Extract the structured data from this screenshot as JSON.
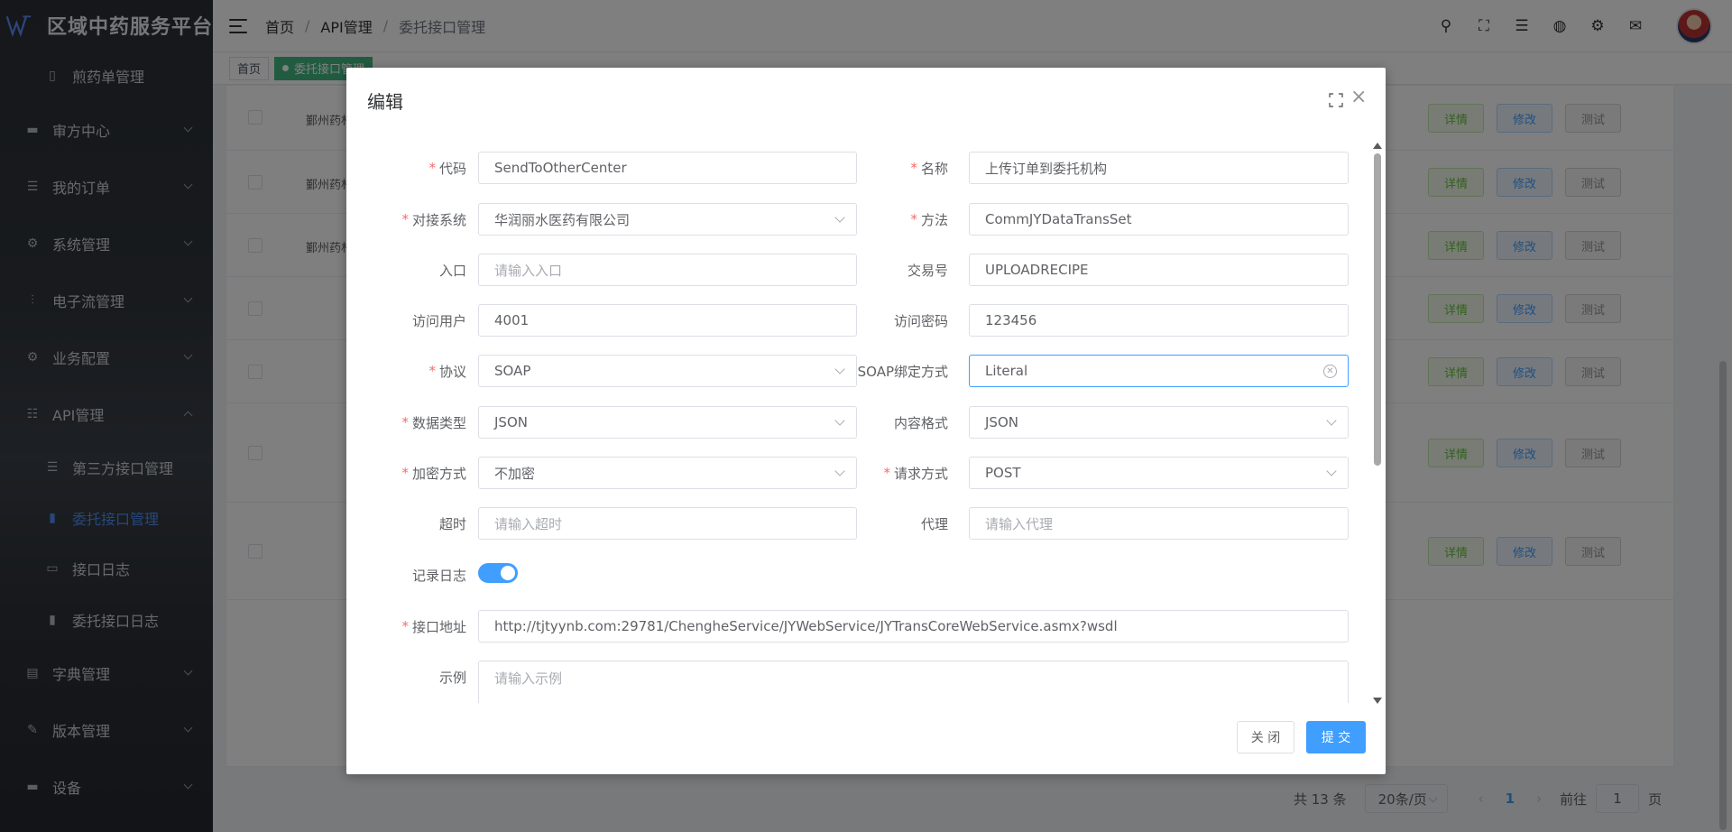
{
  "app": {
    "title": "区域中药服务平台"
  },
  "sidebar": {
    "items": [
      {
        "label": "煎药单管理",
        "icon": "document-icon"
      },
      {
        "label": "审方中心",
        "icon": "monitor-icon"
      },
      {
        "label": "我的订单",
        "icon": "list-icon"
      },
      {
        "label": "系统管理",
        "icon": "gear-icon"
      },
      {
        "label": "电子流管理",
        "icon": "sliders-icon"
      },
      {
        "label": "业务配置",
        "icon": "gear-icon"
      },
      {
        "label": "API管理",
        "icon": "sliders-icon"
      },
      {
        "label": "第三方接口管理",
        "icon": "list-icon"
      },
      {
        "label": "委托接口管理",
        "icon": "bar-chart-icon"
      },
      {
        "label": "接口日志",
        "icon": "log-icon"
      },
      {
        "label": "委托接口日志",
        "icon": "bar-chart-icon"
      },
      {
        "label": "字典管理",
        "icon": "book-icon"
      },
      {
        "label": "版本管理",
        "icon": "edit-icon"
      },
      {
        "label": "设备",
        "icon": "monitor-icon"
      }
    ]
  },
  "header": {
    "breadcrumb": [
      "首页",
      "API管理",
      "委托接口管理"
    ],
    "tools": [
      "search-icon",
      "fullscreen-icon",
      "settings-sliders-icon",
      "globe-icon",
      "gear-icon",
      "mail-icon"
    ]
  },
  "tags": {
    "home": "首页",
    "active": "委托接口管理"
  },
  "table": {
    "row_names": [
      "鄞州药材",
      "鄞州药材",
      "鄞州药材"
    ],
    "btn_detail": "详情",
    "btn_modify": "修改",
    "btn_test": "测试"
  },
  "pagination": {
    "total": "共 13 条",
    "page_size": "20条/页",
    "prev": "‹",
    "current": "1",
    "next": "›",
    "goto_prefix": "前往",
    "goto_value": "1",
    "goto_suffix": "页"
  },
  "dialog": {
    "title": "编辑",
    "fields": {
      "code": {
        "label": "代码",
        "value": "SendToOtherCenter"
      },
      "name": {
        "label": "名称",
        "value": "上传订单到委托机构"
      },
      "system": {
        "label": "对接系统",
        "value": "华润丽水医药有限公司"
      },
      "method": {
        "label": "方法",
        "value": "CommJYDataTransSet"
      },
      "entry": {
        "label": "入口",
        "placeholder": "请输入入口"
      },
      "trade_no": {
        "label": "交易号",
        "value": "UPLOADRECIPE"
      },
      "user": {
        "label": "访问用户",
        "value": "4001"
      },
      "password": {
        "label": "访问密码",
        "value": "123456"
      },
      "protocol": {
        "label": "协议",
        "value": "SOAP"
      },
      "soap_binding": {
        "label": "SOAP绑定方式",
        "value": "Literal"
      },
      "data_type": {
        "label": "数据类型",
        "value": "JSON"
      },
      "content_format": {
        "label": "内容格式",
        "value": "JSON"
      },
      "encryption": {
        "label": "加密方式",
        "value": "不加密"
      },
      "request_method": {
        "label": "请求方式",
        "value": "POST"
      },
      "timeout": {
        "label": "超时",
        "placeholder": "请输入超时"
      },
      "proxy": {
        "label": "代理",
        "placeholder": "请输入代理"
      },
      "log": {
        "label": "记录日志",
        "enabled": true
      },
      "url": {
        "label": "接口地址",
        "value": "http://tjtyynb.com:29781/ChengheService/JYWebService/JYTransCoreWebService.asmx?wsdl"
      },
      "example": {
        "label": "示例",
        "placeholder": "请输入示例"
      }
    },
    "btn_close": "关 闭",
    "btn_submit": "提 交"
  },
  "colors": {
    "primary": "#409eff",
    "required": "#f56c6c",
    "tag_active": "#42b983"
  }
}
